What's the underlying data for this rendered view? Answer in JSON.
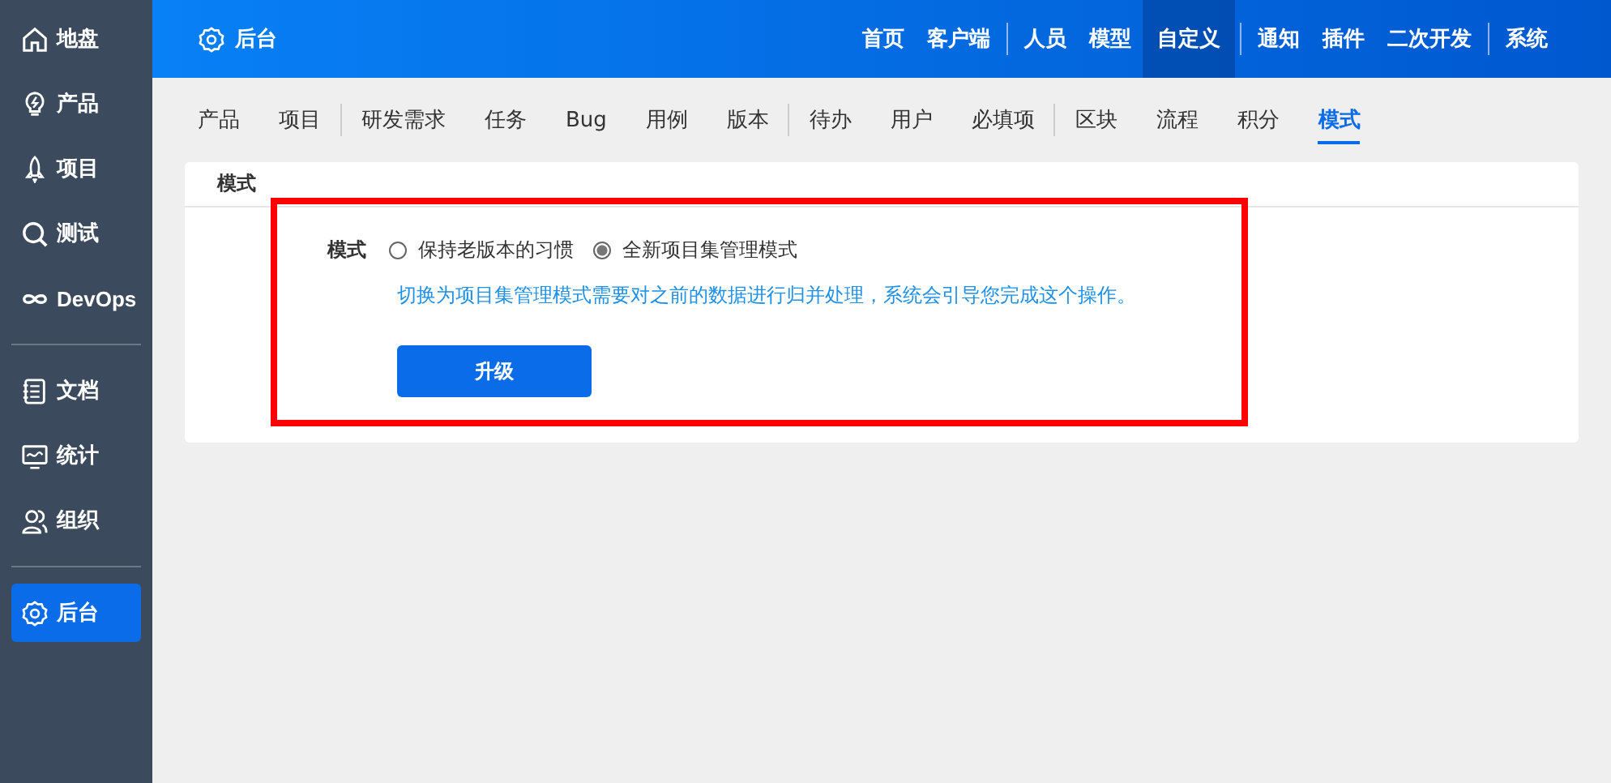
{
  "sidebar": {
    "groups": [
      [
        {
          "label": "地盘",
          "kind": "home",
          "selected": false
        },
        {
          "label": "产品",
          "kind": "bulb",
          "selected": false
        },
        {
          "label": "项目",
          "kind": "rocket",
          "selected": false
        },
        {
          "label": "测试",
          "kind": "search",
          "selected": false
        },
        {
          "label": "DevOps",
          "kind": "infinity",
          "selected": false
        }
      ],
      [
        {
          "label": "文档",
          "kind": "doc",
          "selected": false
        },
        {
          "label": "统计",
          "kind": "chart",
          "selected": false
        },
        {
          "label": "组织",
          "kind": "people",
          "selected": false
        }
      ],
      [
        {
          "label": "后台",
          "kind": "gear",
          "selected": true
        }
      ]
    ]
  },
  "header": {
    "title": "后台",
    "nav_groups": [
      [
        {
          "label": "首页",
          "selected": false
        },
        {
          "label": "客户端",
          "selected": false
        }
      ],
      [
        {
          "label": "人员",
          "selected": false
        },
        {
          "label": "模型",
          "selected": false
        },
        {
          "label": "自定义",
          "selected": true
        }
      ],
      [
        {
          "label": "通知",
          "selected": false
        },
        {
          "label": "插件",
          "selected": false
        },
        {
          "label": "二次开发",
          "selected": false
        }
      ],
      [
        {
          "label": "系统",
          "selected": false
        }
      ]
    ]
  },
  "subnav_groups": [
    [
      {
        "label": "产品",
        "selected": false
      },
      {
        "label": "项目",
        "selected": false
      }
    ],
    [
      {
        "label": "研发需求",
        "selected": false
      },
      {
        "label": "任务",
        "selected": false
      },
      {
        "label": "Bug",
        "selected": false
      },
      {
        "label": "用例",
        "selected": false
      },
      {
        "label": "版本",
        "selected": false
      }
    ],
    [
      {
        "label": "待办",
        "selected": false
      },
      {
        "label": "用户",
        "selected": false
      },
      {
        "label": "必填项",
        "selected": false
      }
    ],
    [
      {
        "label": "区块",
        "selected": false
      },
      {
        "label": "流程",
        "selected": false
      },
      {
        "label": "积分",
        "selected": false
      },
      {
        "label": "模式",
        "selected": true
      }
    ]
  ],
  "panel": {
    "title": "模式",
    "field_label": "模式",
    "options": [
      {
        "label": "保持老版本的习惯",
        "selected": false
      },
      {
        "label": "全新项目集管理模式",
        "selected": true
      }
    ],
    "hint": "切换为项目集管理模式需要对之前的数据进行归并处理，系统会引导您完成这个操作。",
    "button": "升级"
  }
}
